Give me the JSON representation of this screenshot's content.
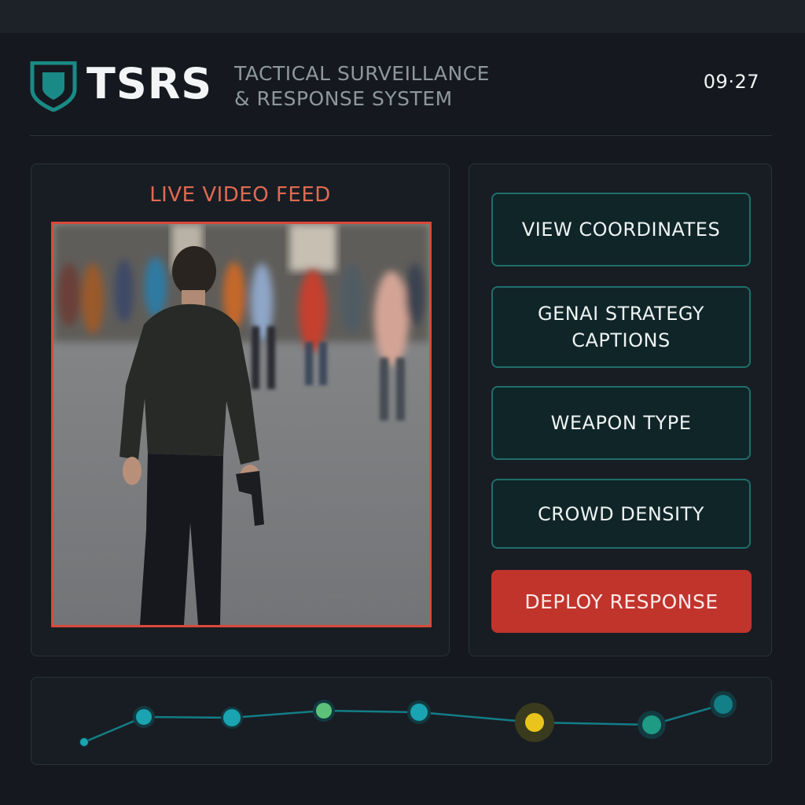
{
  "header": {
    "brand": "TSRS",
    "subtitle_line1": "TACTICAL SURVEILLANCE",
    "subtitle_line2": "& RESPONSE SYSTEM",
    "clock": "09·27"
  },
  "feed": {
    "title": "LIVE VIDEO FEED"
  },
  "actions": {
    "view_coordinates": "VIEW COORDINATES",
    "genai_line1": "GENAI STRATEGY",
    "genai_line2": "CAPTIONS",
    "weapon_type": "WEAPON TYPE",
    "crowd_density": "CROWD DENSITY",
    "deploy": "DEPLOY RESPONSE"
  },
  "timeline": {
    "events": [
      {
        "status": "minor",
        "color": "#1aa3b0"
      },
      {
        "status": "normal",
        "color": "#1aa3b0"
      },
      {
        "status": "normal",
        "color": "#1aa3b0"
      },
      {
        "status": "clear",
        "color": "#5cc27a"
      },
      {
        "status": "normal",
        "color": "#1aa3b0"
      },
      {
        "status": "alert",
        "color": "#e8c41c"
      },
      {
        "status": "normal",
        "color": "#1f9a83"
      },
      {
        "status": "normal",
        "color": "#137f86"
      }
    ]
  },
  "colors": {
    "accent": "#1f6e6c",
    "alert": "#d9493b",
    "deploy": "#c0342c"
  }
}
